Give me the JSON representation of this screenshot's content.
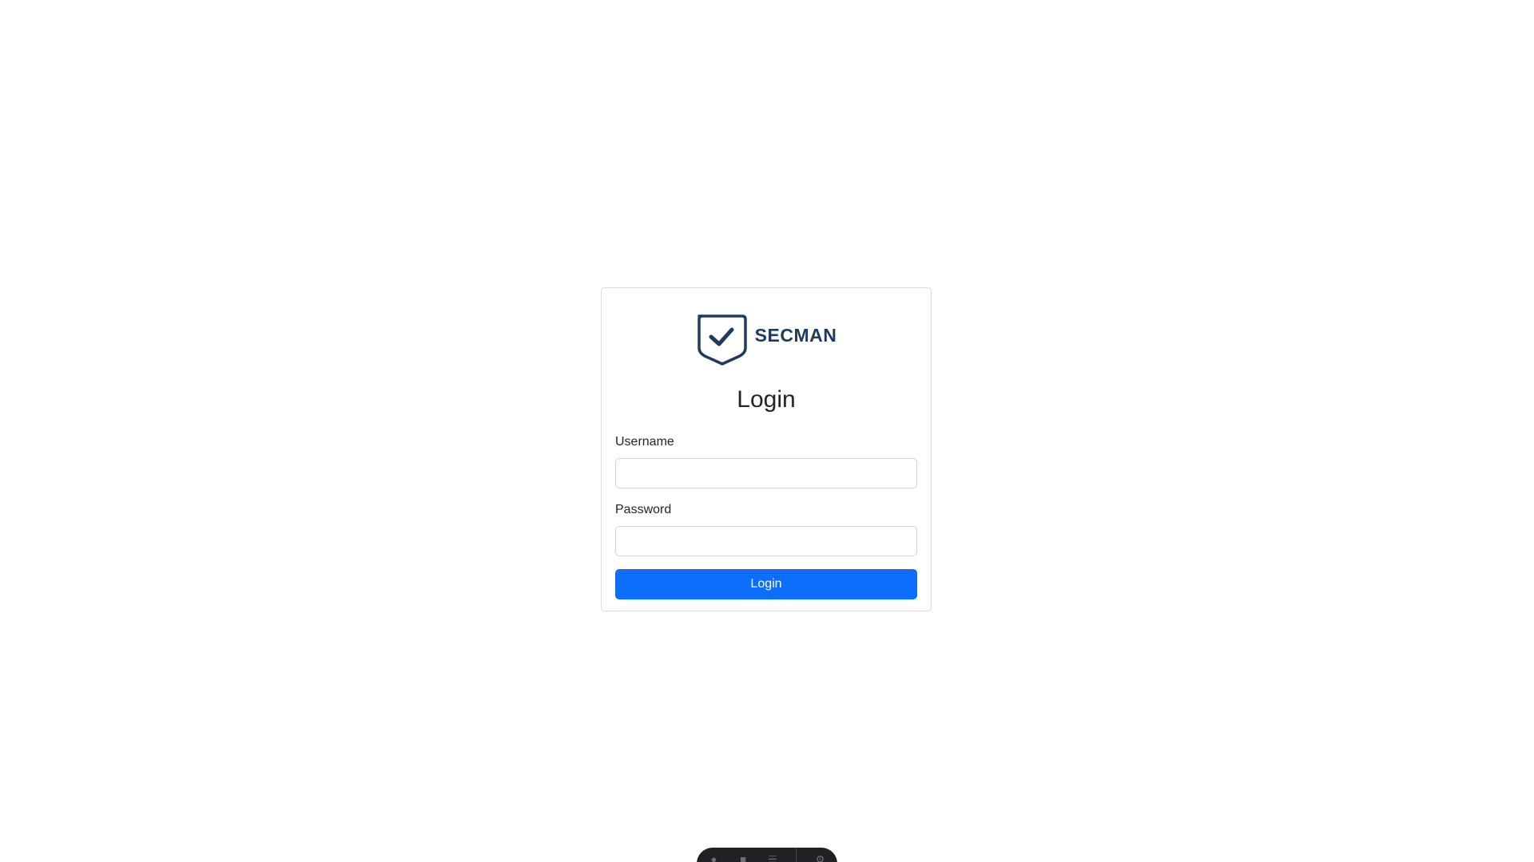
{
  "brand": {
    "name": "SECMAN",
    "logo_icon": "shield-check-icon",
    "color": "#1e3a5f"
  },
  "login_form": {
    "title": "Login",
    "username_label": "Username",
    "username_value": "",
    "password_label": "Password",
    "password_value": "",
    "submit_label": "Login",
    "submit_color": "#0d6efd"
  },
  "dock": {
    "icons": [
      "microphone-icon",
      "camera-icon",
      "menu-icon",
      "settings-icon"
    ]
  }
}
